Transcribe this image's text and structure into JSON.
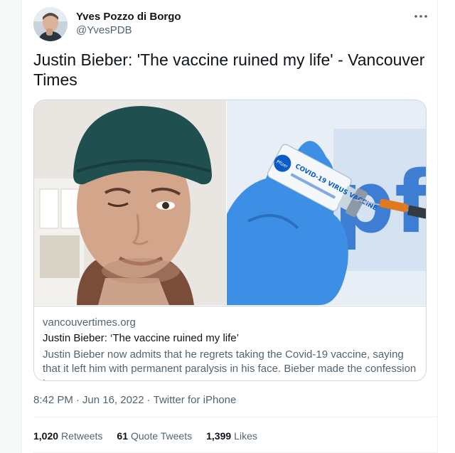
{
  "author": {
    "display_name": "Yves Pozzo di Borgo",
    "handle": "@YvesPDB",
    "avatar_icon": "avatar-photo"
  },
  "tweet": {
    "text": "Justin Bieber: 'The vaccine ruined my life' - Vancouver Times"
  },
  "card": {
    "domain": "vancouvertimes.org",
    "title": "Justin Bieber: ‘The vaccine ruined my life’",
    "description": "Justin Bieber now admits that he regrets taking the Covid-19 vaccine, saying that it left him with permanent paralysis in his face. Bieber made the confession to ...",
    "vial_label": "COVID-19 VIRUS VACCINE",
    "brand_badge": "Pfizer",
    "brand_backdrop": "pfi"
  },
  "meta": {
    "time": "8:42 PM",
    "date": "Jun 16, 2022",
    "source": "Twitter for iPhone",
    "separator": "·"
  },
  "stats": {
    "retweets_count": "1,020",
    "retweets_label": "Retweets",
    "quotes_count": "61",
    "quotes_label": "Quote Tweets",
    "likes_count": "1,399",
    "likes_label": "Likes"
  },
  "colors": {
    "text_primary": "#0f1419",
    "text_secondary": "#536471",
    "border": "#cfd9de",
    "glove_blue": "#3d8fe6",
    "pfizer_blue": "#0b5cc9"
  }
}
